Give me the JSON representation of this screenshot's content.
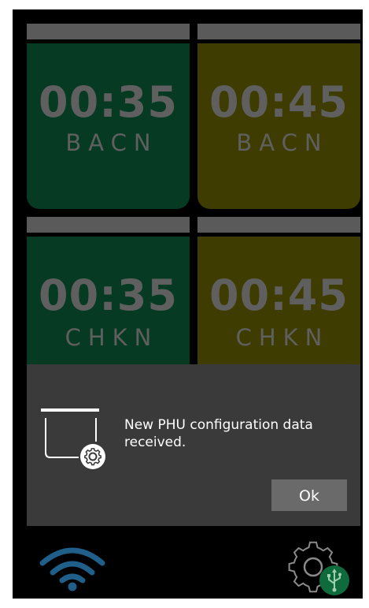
{
  "tiles": [
    {
      "time": "00:35",
      "label": "BACN",
      "color": "#063a22"
    },
    {
      "time": "00:45",
      "label": "BACN",
      "color": "#3e3c00"
    },
    {
      "time": "00:35",
      "label": "CHKN",
      "color": "#063a22"
    },
    {
      "time": "00:45",
      "label": "CHKN",
      "color": "#3e3c00"
    }
  ],
  "dialog": {
    "message": "New PHU configuration data received.",
    "ok_label": "Ok",
    "icon": "config-download-icon"
  },
  "footer": {
    "wifi_icon": "wifi-icon",
    "wifi_color": "#1f5f8a",
    "settings_icon": "gear-icon",
    "usb_icon": "usb-icon",
    "usb_badge_color": "#0f6b3c"
  }
}
